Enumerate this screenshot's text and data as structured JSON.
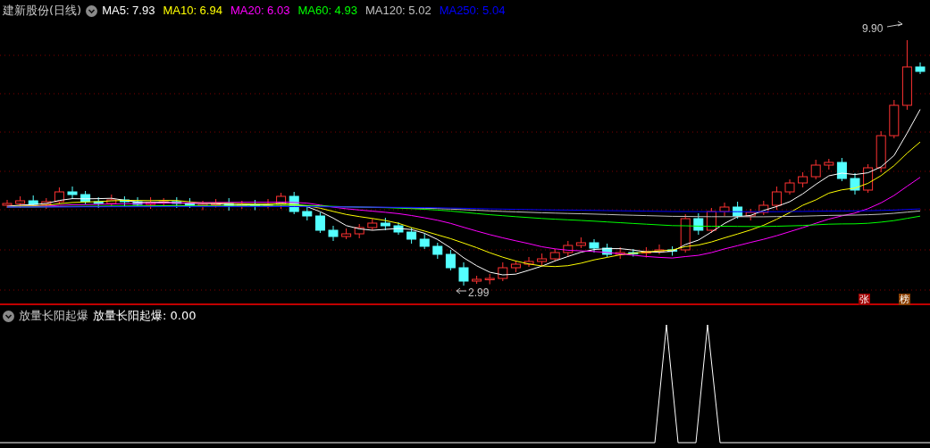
{
  "header": {
    "title": "建新股份(日线)",
    "indicators": [
      {
        "label": "MA5: 7.93",
        "color": "#ffffff"
      },
      {
        "label": "MA10: 6.94",
        "color": "#ffff00"
      },
      {
        "label": "MA20: 6.03",
        "color": "#ff00ff"
      },
      {
        "label": "MA60: 4.93",
        "color": "#00ff00"
      },
      {
        "label": "MA120: 5.02",
        "color": "#c0c0c0"
      },
      {
        "label": "MA250: 5.04",
        "color": "#0000ff"
      }
    ]
  },
  "price_high": "9.90",
  "price_low": "2.99",
  "badges": [
    {
      "text": "张",
      "color": "#a00000"
    },
    {
      "text": "榜",
      "color": "#8a4000"
    }
  ],
  "lower_panel": {
    "title": "放量长阳起爆",
    "reading": "放量长阳起爆: 0.00"
  }
}
